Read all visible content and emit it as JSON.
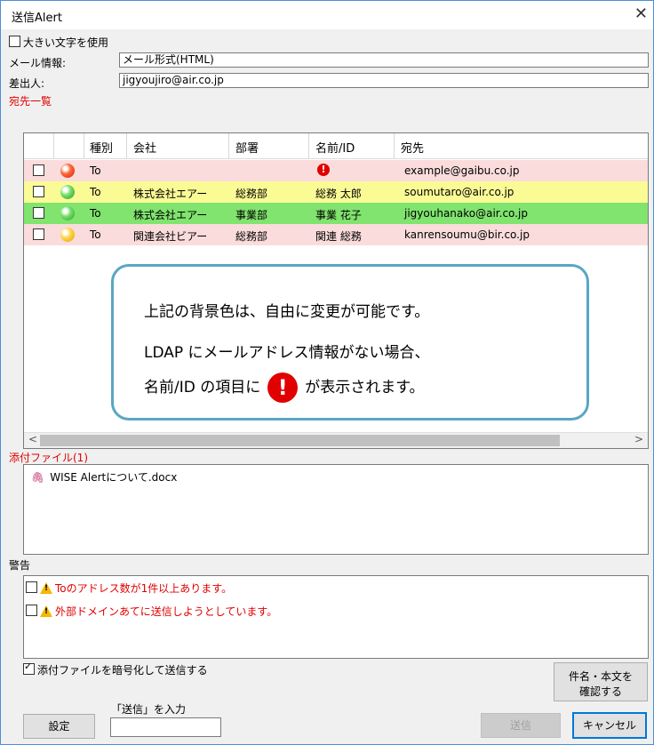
{
  "window": {
    "title": "送信Alert",
    "close_icon": "close-icon"
  },
  "options": {
    "large_text": "大きい文字を使用",
    "large_text_checked": false
  },
  "mail_info": {
    "label": "メール情報:",
    "value": "メール形式(HTML)"
  },
  "sender": {
    "label": "差出人:",
    "value": "jigyoujiro@air.co.jp"
  },
  "recipients": {
    "section_label": "宛先一覧",
    "columns": [
      "種別",
      "会社",
      "部署",
      "名前/ID",
      "宛先"
    ],
    "rows": [
      {
        "type": "To",
        "company": "",
        "dept": "",
        "name": "",
        "address": "example@gaibu.co.jp",
        "bg": "#fadcdc",
        "ball": "red",
        "no_ldap": true
      },
      {
        "type": "To",
        "company": "株式会社エアー",
        "dept": "総務部",
        "name": "総務 太郎",
        "address": "soumutaro@air.co.jp",
        "bg": "#fbfb96",
        "ball": "green",
        "no_ldap": false
      },
      {
        "type": "To",
        "company": "株式会社エアー",
        "dept": "事業部",
        "name": "事業 花子",
        "address": "jigyouhanako@air.co.jp",
        "bg": "#80e46e",
        "ball": "green",
        "no_ldap": false
      },
      {
        "type": "To",
        "company": "関連会社ビアー",
        "dept": "総務部",
        "name": "関連 総務",
        "address": "kanrensoumu@bir.co.jp",
        "bg": "#fadcdc",
        "ball": "yellow",
        "no_ldap": false
      }
    ]
  },
  "callout": {
    "line1": "上記の背景色は、自由に変更が可能です。",
    "line2": "LDAP にメールアドレス情報がない場合、",
    "line3_prefix": "名前/ID の項目に",
    "line3_suffix": "が表示されます。"
  },
  "attachments": {
    "section_label": "添付ファイル(1)",
    "files": [
      {
        "name": "WISE Alertについて.docx",
        "icon": "paperclip-icon"
      }
    ]
  },
  "warnings": {
    "section_label": "警告",
    "items": [
      "Toのアドレス数が1件以上あります。",
      "外部ドメインあてに送信しようとしています。"
    ]
  },
  "encrypt": {
    "label": "添付ファイルを暗号化して送信する",
    "checked": true
  },
  "buttons": {
    "settings": "設定",
    "confirm_line1": "件名・本文を",
    "confirm_line2": "確認する",
    "send_prompt": "「送信」を入力",
    "send": "送信",
    "cancel": "キャンセル"
  },
  "colors": {
    "section_label": "#e00000",
    "callout_border": "#5aa6c4"
  }
}
